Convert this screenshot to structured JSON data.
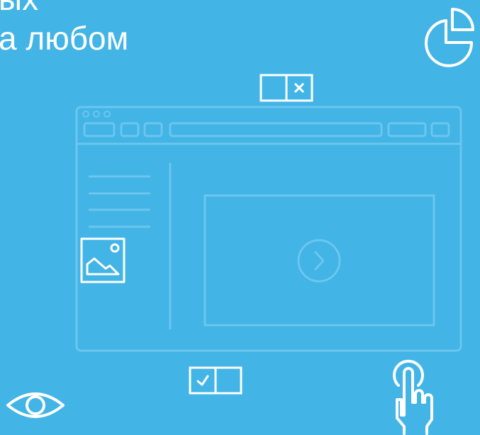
{
  "heading": {
    "line1": "ых",
    "line2": "а любом"
  },
  "icons": [
    "pie-chart-icon",
    "toggle-close-icon",
    "browser-window-illustration",
    "image-icon",
    "play-icon",
    "toggle-check-icon",
    "eye-icon",
    "hand-pointer-icon"
  ],
  "colors": {
    "background": "#42b4e6",
    "foreground": "#ffffff",
    "wireframe": "#6cc6ef"
  }
}
